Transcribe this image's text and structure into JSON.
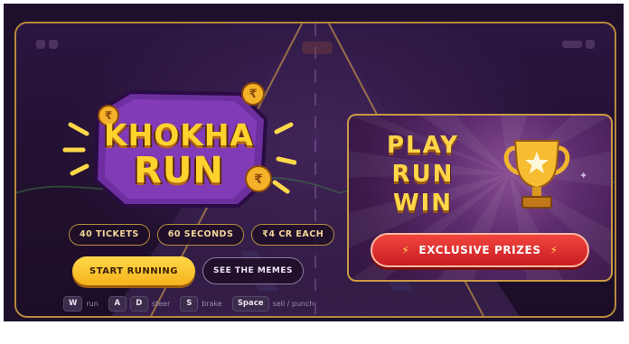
{
  "logo": {
    "line1": "KHOKHA",
    "line2": "RUN",
    "coin_symbol": "₹"
  },
  "chips": [
    "40 TICKETS",
    "60 SECONDS",
    "₹4 CR EACH"
  ],
  "buttons": {
    "start": "START RUNNING",
    "memes": "SEE THE MEMES"
  },
  "controls": [
    {
      "keys": [
        "W"
      ],
      "label": "run"
    },
    {
      "keys": [
        "A",
        "D"
      ],
      "label": "steer"
    },
    {
      "keys": [
        "S"
      ],
      "label": "brake"
    },
    {
      "keys": [
        "Space"
      ],
      "label": "sell / punch"
    }
  ],
  "promo": {
    "lines": [
      "PLAY",
      "RUN",
      "WIN"
    ],
    "button": "EXCLUSIVE PRIZES",
    "icon": "trophy-icon",
    "bolt_glyph": "⚡"
  },
  "colors": {
    "accent_gold": "#ffd32e",
    "frame_border": "#b58a3c",
    "prize_red": "#d8282a",
    "background": "#21102f"
  }
}
